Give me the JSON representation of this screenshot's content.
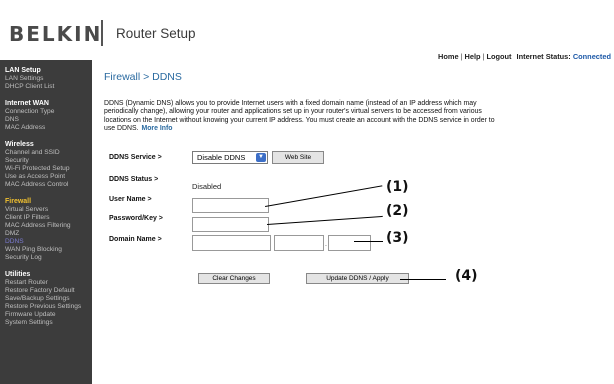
{
  "header": {
    "logo": "BELKIN",
    "app_title": "Router Setup",
    "nav": {
      "home": "Home",
      "help": "Help",
      "logout": "Logout",
      "status_label": "Internet Status:",
      "status_value": "Connected"
    }
  },
  "sidebar": {
    "sections": [
      {
        "title": "LAN Setup",
        "items": [
          "LAN Settings",
          "DHCP Client List"
        ]
      },
      {
        "title": "Internet WAN",
        "items": [
          "Connection Type",
          "DNS",
          "MAC Address"
        ]
      },
      {
        "title": "Wireless",
        "items": [
          "Channel and SSID",
          "Security",
          "Wi-Fi Protected Setup",
          "Use as Access Point",
          "MAC Address Control"
        ]
      },
      {
        "title": "Firewall",
        "items": [
          "Virtual Servers",
          "Client IP Filters",
          "MAC Address Filtering",
          "DMZ",
          "DDNS",
          "WAN Ping Blocking",
          "Security Log"
        ]
      },
      {
        "title": "Utilities",
        "items": [
          "Restart Router",
          "Restore Factory Default",
          "Save/Backup Settings",
          "Restore Previous Settings",
          "Firmware Update",
          "System Settings"
        ]
      }
    ],
    "active_section": "Firewall",
    "current_item": "DDNS"
  },
  "main": {
    "title": "Firewall > DDNS",
    "description": "DDNS (Dynamic DNS) allows you to provide Internet users with a fixed domain name (instead of an IP address which may periodically change), allowing your router and applications set up in your router's virtual servers to be accessed from various locations on the Internet without knowing your current IP address. You must create an account with the DDNS service in order to use DDNS.",
    "more_info": "More Info",
    "labels": {
      "service": "DDNS Service >",
      "status": "DDNS Status >",
      "user": "User Name >",
      "password": "Password/Key >",
      "domain": "Domain Name >"
    },
    "service_selected": "Disable DDNS",
    "website_button": "Web Site",
    "status_value": "Disabled",
    "domain_dot": ".",
    "clear_button": "Clear Changes",
    "update_button": "Update DDNS / Apply"
  },
  "callouts": [
    "(1)",
    "(2)",
    "(3)",
    "(4)"
  ]
}
